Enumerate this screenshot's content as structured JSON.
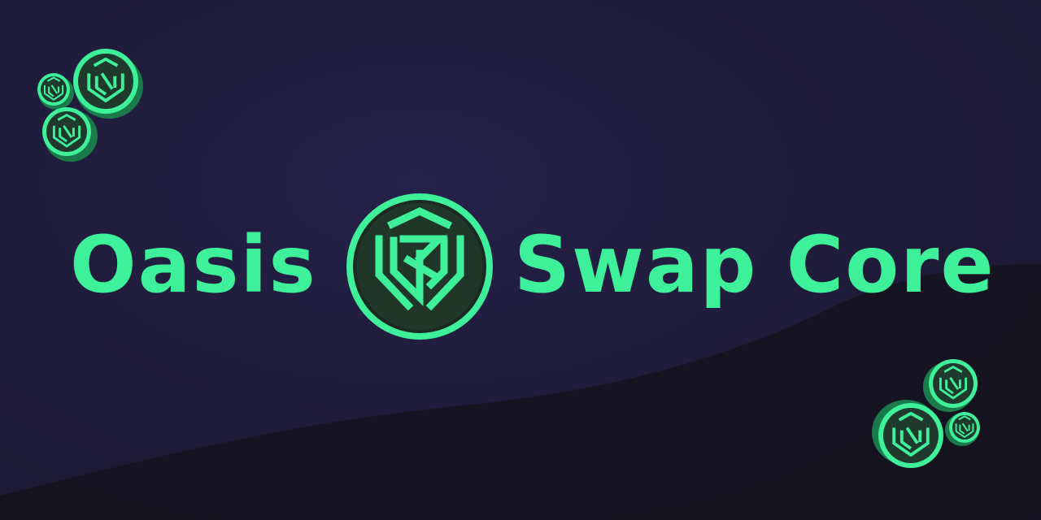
{
  "brand": {
    "title_left": "Oasis",
    "title_right": "Swap Core",
    "logo_icon": "oasis-swap-logo-icon",
    "accent_color": "#3ef09a",
    "background_color": "#1f1c38"
  },
  "decorations": {
    "coin_icon": "oasis-swap-coin-icon",
    "top_left_coins": 3,
    "bottom_right_coins": 3
  }
}
